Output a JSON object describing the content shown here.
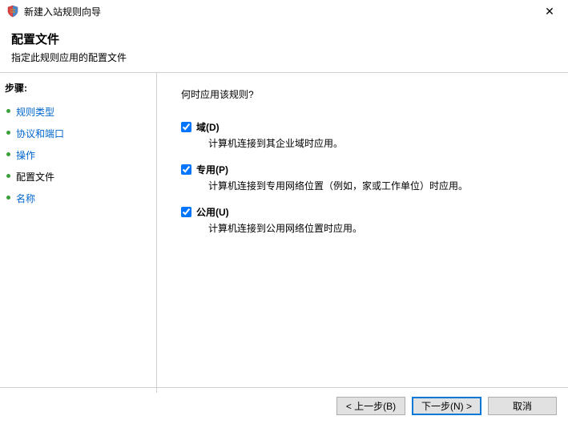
{
  "window": {
    "title": "新建入站规则向导"
  },
  "header": {
    "title": "配置文件",
    "subtitle": "指定此规则应用的配置文件"
  },
  "sidebar": {
    "steps_label": "步骤:",
    "items": [
      {
        "label": "规则类型"
      },
      {
        "label": "协议和端口"
      },
      {
        "label": "操作"
      },
      {
        "label": "配置文件"
      },
      {
        "label": "名称"
      }
    ]
  },
  "content": {
    "prompt": "何时应用该规则?",
    "checkboxes": [
      {
        "label": "域(D)",
        "desc": "计算机连接到其企业域时应用。"
      },
      {
        "label": "专用(P)",
        "desc": "计算机连接到专用网络位置（例如，家或工作单位）时应用。"
      },
      {
        "label": "公用(U)",
        "desc": "计算机连接到公用网络位置时应用。"
      }
    ]
  },
  "footer": {
    "back": "< 上一步(B)",
    "next": "下一步(N) >",
    "cancel": "取消"
  }
}
